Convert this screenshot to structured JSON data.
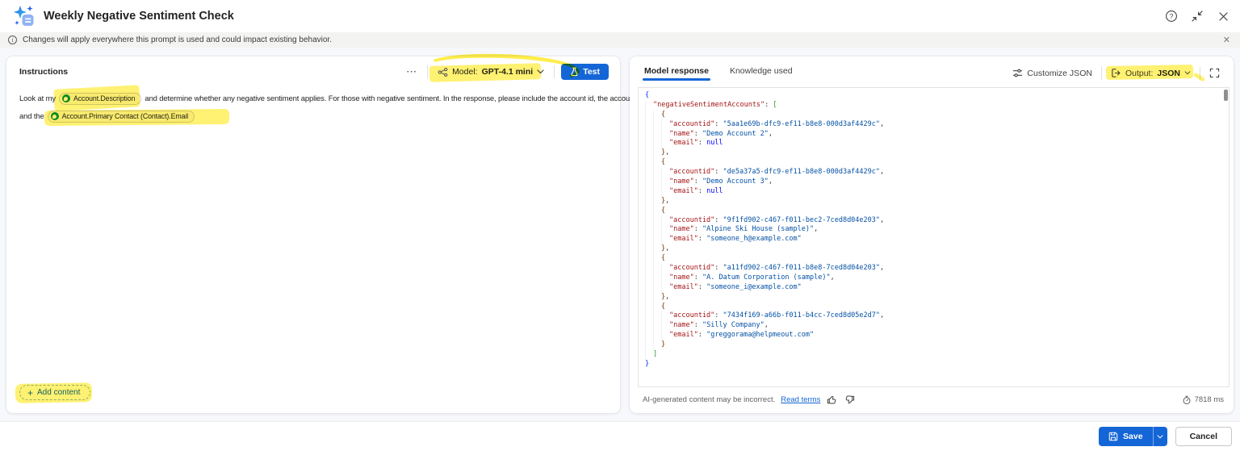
{
  "window": {
    "title": "Weekly Negative Sentiment Check"
  },
  "banner": {
    "text": "Changes will apply everywhere this prompt is used and could impact existing behavior."
  },
  "instructions": {
    "title": "Instructions",
    "more": "⋯",
    "model_label": "Model:",
    "model_value": "GPT-4.1 mini",
    "test_label": "Test",
    "line1_pre": "Look at my",
    "token1": "Account.Description",
    "line1_post": "and determine whether any negative sentiment applies.  For those with negative sentiment.  In the response, please include the account id, the account name",
    "line2_pre": "and the",
    "token2": "Account.Primary Contact (Contact).Email",
    "add_content": "Add content"
  },
  "response": {
    "tab_model": "Model response",
    "tab_knowledge": "Knowledge used",
    "customize": "Customize JSON",
    "output_label": "Output:",
    "output_value": "JSON",
    "disclaimer": "AI-generated content may be incorrect.",
    "read_terms": "Read terms",
    "latency": "7818 ms"
  },
  "json_output": {
    "root_key": "negativeSentimentAccounts",
    "accounts": [
      {
        "accountid": "5aa1e69b-dfc9-ef11-b8e8-000d3af4429c",
        "name": "Demo Account 2",
        "email": null
      },
      {
        "accountid": "de5a37a5-dfc9-ef11-b8e8-000d3af4429c",
        "name": "Demo Account 3",
        "email": null
      },
      {
        "accountid": "9f1fd902-c467-f011-bec2-7ced8d04e203",
        "name": "Alpine Ski House (sample)",
        "email": "someone_h@example.com"
      },
      {
        "accountid": "a11fd902-c467-f011-b8e8-7ced8d04e203",
        "name": "A. Datum Corporation (sample)",
        "email": "someone_i@example.com"
      },
      {
        "accountid": "7434f169-a66b-f011-b4cc-7ced8d05e2d7",
        "name": "Silly Company",
        "email": "greggorama@helpmeout.com"
      }
    ]
  },
  "footer": {
    "save": "Save",
    "cancel": "Cancel"
  },
  "colors": {
    "accent": "#1466d6",
    "marker": "#ffe81a",
    "json_key": "#a31515",
    "json_string": "#0451a5",
    "json_keyword": "#0000ff"
  }
}
